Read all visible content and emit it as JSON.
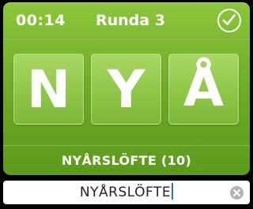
{
  "header": {
    "timer": "00:14",
    "round": "Runda 3",
    "done_icon": "check-circle-icon"
  },
  "tiles": [
    "N",
    "Y",
    "Å"
  ],
  "answer": {
    "word": "NYÅRSLÖFTE (10)"
  },
  "input": {
    "value": "NYÅRSLÖFTE",
    "clear_icon": "clear-icon"
  },
  "colors": {
    "panel_green": "#74b42d",
    "tile_green": "#8cc545",
    "caret_blue": "#2b6fd1"
  }
}
